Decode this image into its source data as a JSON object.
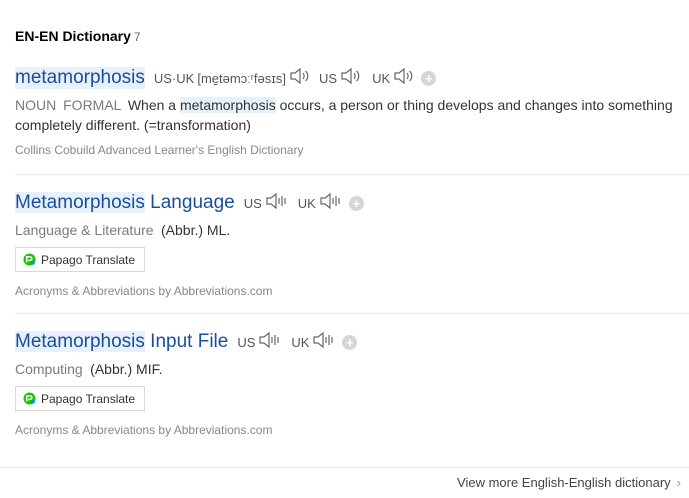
{
  "header": {
    "title": "EN-EN Dictionary",
    "count": "7"
  },
  "entries": [
    {
      "word_hl": "metamorphosis",
      "word_rest": "",
      "usuk_label": "US·UK",
      "ipa": "[me̠təmɔːʳfəsɪs]",
      "us_label": "US",
      "uk_label": "UK",
      "pos": "NOUN",
      "register": "FORMAL",
      "def_before": "When a",
      "def_hl": "metamorphosis",
      "def_after": "occurs, a person or thing develops and changes into something",
      "def_line2": "completely different. (=transformation)",
      "source": "Collins Cobuild Advanced Learner's English Dictionary"
    },
    {
      "word_hl": "Metamorphosis",
      "word_rest": "Language",
      "us_label": "US",
      "uk_label": "UK",
      "category": "Language & Literature",
      "abbr": "(Abbr.) ML.",
      "translate_label": "Papago Translate",
      "source": "Acronyms & Abbreviations by Abbreviations.com"
    },
    {
      "word_hl": "Metamorphosis",
      "word_rest": "Input File",
      "us_label": "US",
      "uk_label": "UK",
      "category": "Computing",
      "abbr": "(Abbr.) MIF.",
      "translate_label": "Papago Translate",
      "source": "Acronyms & Abbreviations by Abbreviations.com"
    }
  ],
  "footer": {
    "more_label": "View more English-English dictionary"
  },
  "icons": {
    "speaker": "speaker-icon",
    "add": "add-icon",
    "papago": "papago-icon",
    "chevron": "chevron-right-icon"
  },
  "colors": {
    "word": "#1a4e9c",
    "highlight": "#e7f1fb",
    "papago_green": "#1ec800",
    "papago_blue": "#0a8fe5"
  }
}
